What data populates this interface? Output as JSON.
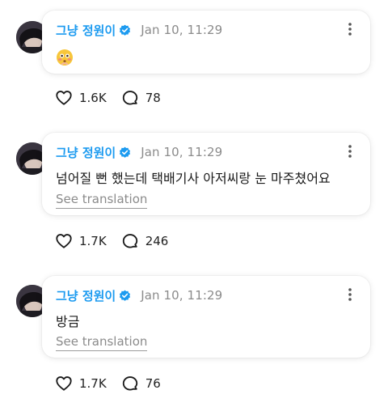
{
  "posts": [
    {
      "author": "그냥 정원이",
      "time": "Jan 10, 11:29",
      "text": "",
      "emoji": "flushed-face-emoji",
      "translate": "",
      "likes": "1.6K",
      "replies": "78"
    },
    {
      "author": "그냥 정원이",
      "time": "Jan 10, 11:29",
      "text": "넘어질 뻔 했는데 택배기사 아저씨랑 눈 마주쳤어요",
      "translate": "See translation",
      "likes": "1.7K",
      "replies": "246"
    },
    {
      "author": "그냥 정원이",
      "time": "Jan 10, 11:29",
      "text": "방금",
      "translate": "See translation",
      "likes": "1.7K",
      "replies": "76"
    }
  ],
  "colors": {
    "author": "#1d9bf0",
    "muted": "#8b8b8b",
    "verified": "#1d9bf0"
  }
}
